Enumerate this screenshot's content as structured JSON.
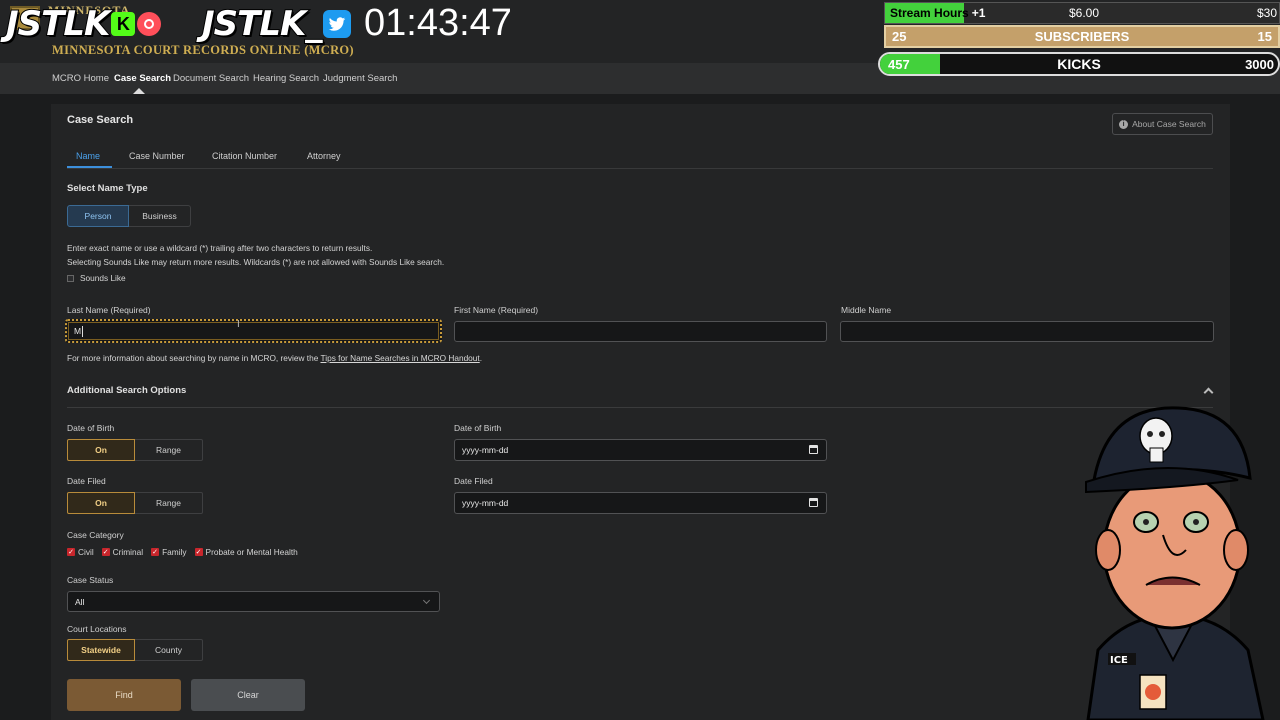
{
  "header": {
    "state_label": "MINNESOTA",
    "site_title": "MINNESOTA COURT RECORDS ONLINE (MCRO)"
  },
  "nav": {
    "items": [
      "MCRO Home",
      "Case Search",
      "Document Search",
      "Hearing Search",
      "Judgment Search"
    ],
    "active": "Case Search"
  },
  "page": {
    "title": "Case Search",
    "about_button": "About Case Search",
    "tabs": [
      "Name",
      "Case Number",
      "Citation Number",
      "Attorney"
    ],
    "active_tab": "Name"
  },
  "name_type": {
    "heading": "Select Name Type",
    "options": [
      "Person",
      "Business"
    ],
    "selected": "Person"
  },
  "help": {
    "line1": "Enter exact name or use a wildcard (*) trailing after two characters to return results.",
    "line2": "Selecting Sounds Like may return more results. Wildcards (*) are not allowed with Sounds Like search.",
    "sounds_like_label": "Sounds Like",
    "sounds_like_checked": false
  },
  "name_fields": {
    "last_label": "Last Name (Required)",
    "last_value": "M",
    "first_label": "First Name (Required)",
    "first_value": "",
    "middle_label": "Middle Name",
    "middle_value": ""
  },
  "tips": {
    "prefix": "For more information about searching by name in MCRO, review the ",
    "link": "Tips for Name Searches in MCRO Handout",
    "suffix": "."
  },
  "additional": {
    "heading": "Additional Search Options",
    "dob_label": "Date of Birth",
    "dob_toggle": [
      "On",
      "Range"
    ],
    "dob_field_label": "Date of Birth",
    "dob_placeholder": "yyyy-mm-dd",
    "filed_label": "Date Filed",
    "filed_toggle": [
      "On",
      "Range"
    ],
    "filed_field_label": "Date Filed",
    "filed_placeholder": "yyyy-mm-dd",
    "category_label": "Case Category",
    "categories": [
      "Civil",
      "Criminal",
      "Family",
      "Probate or Mental Health"
    ],
    "status_label": "Case Status",
    "status_value": "All",
    "court_label": "Court Locations",
    "court_options": [
      "Statewide",
      "County"
    ],
    "court_selected": "Statewide"
  },
  "buttons": {
    "find": "Find",
    "clear": "Clear"
  },
  "overlay": {
    "brand1": "JSTLK",
    "kick_letter": "K",
    "brand2": "JSTLK_",
    "timer": "01:43:47",
    "stream_hours_label": "Stream Hours",
    "stream_hours_increment": "+1",
    "stream_hours_price": "$6.00",
    "stream_hours_goal": "$30",
    "stream_hours_progress": 0.2,
    "subs_current": "25",
    "subs_label": "SUBSCRIBERS",
    "subs_goal": "15",
    "kicks_current": "457",
    "kicks_label": "KICKS",
    "kicks_goal": "3000",
    "kicks_progress": 0.152,
    "avatar_cap_text": "ICE"
  },
  "colors": {
    "accent_blue": "#4aa0ea",
    "accent_gold": "#c89b3a",
    "find_button": "#7b5a34",
    "kick_green": "#53fc18"
  }
}
